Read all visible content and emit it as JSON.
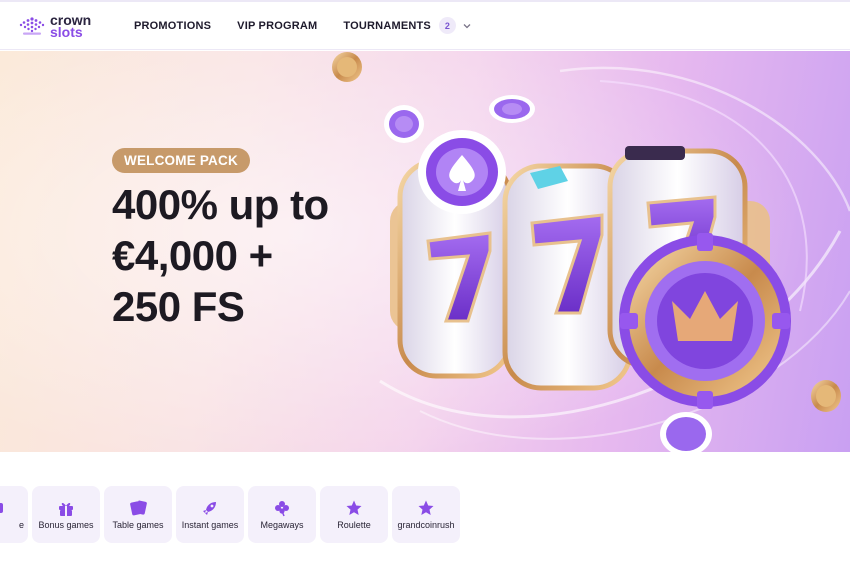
{
  "brand": {
    "line1": "crown",
    "line2": "slots"
  },
  "nav": {
    "promotions": "PROMOTIONS",
    "vip": "VIP PROGRAM",
    "tournaments": "TOURNAMENTS",
    "tournaments_count": "2"
  },
  "hero": {
    "pill": "WELCOME PACK",
    "title_lines": [
      "400% up to",
      "€4,000 +",
      "250 FS"
    ]
  },
  "categories": [
    {
      "label": "e",
      "icon": "partial-icon"
    },
    {
      "label": "Bonus games",
      "icon": "gift-icon"
    },
    {
      "label": "Table games",
      "icon": "cards-icon"
    },
    {
      "label": "Instant games",
      "icon": "rocket-icon"
    },
    {
      "label": "Megaways",
      "icon": "clover-icon"
    },
    {
      "label": "Roulette",
      "icon": "star-icon"
    },
    {
      "label": "grandcoinrush",
      "icon": "star-icon"
    }
  ],
  "colors": {
    "accent": "#8a4ce6",
    "pill": "#c79a6a",
    "tile": "#f4f0fb"
  }
}
